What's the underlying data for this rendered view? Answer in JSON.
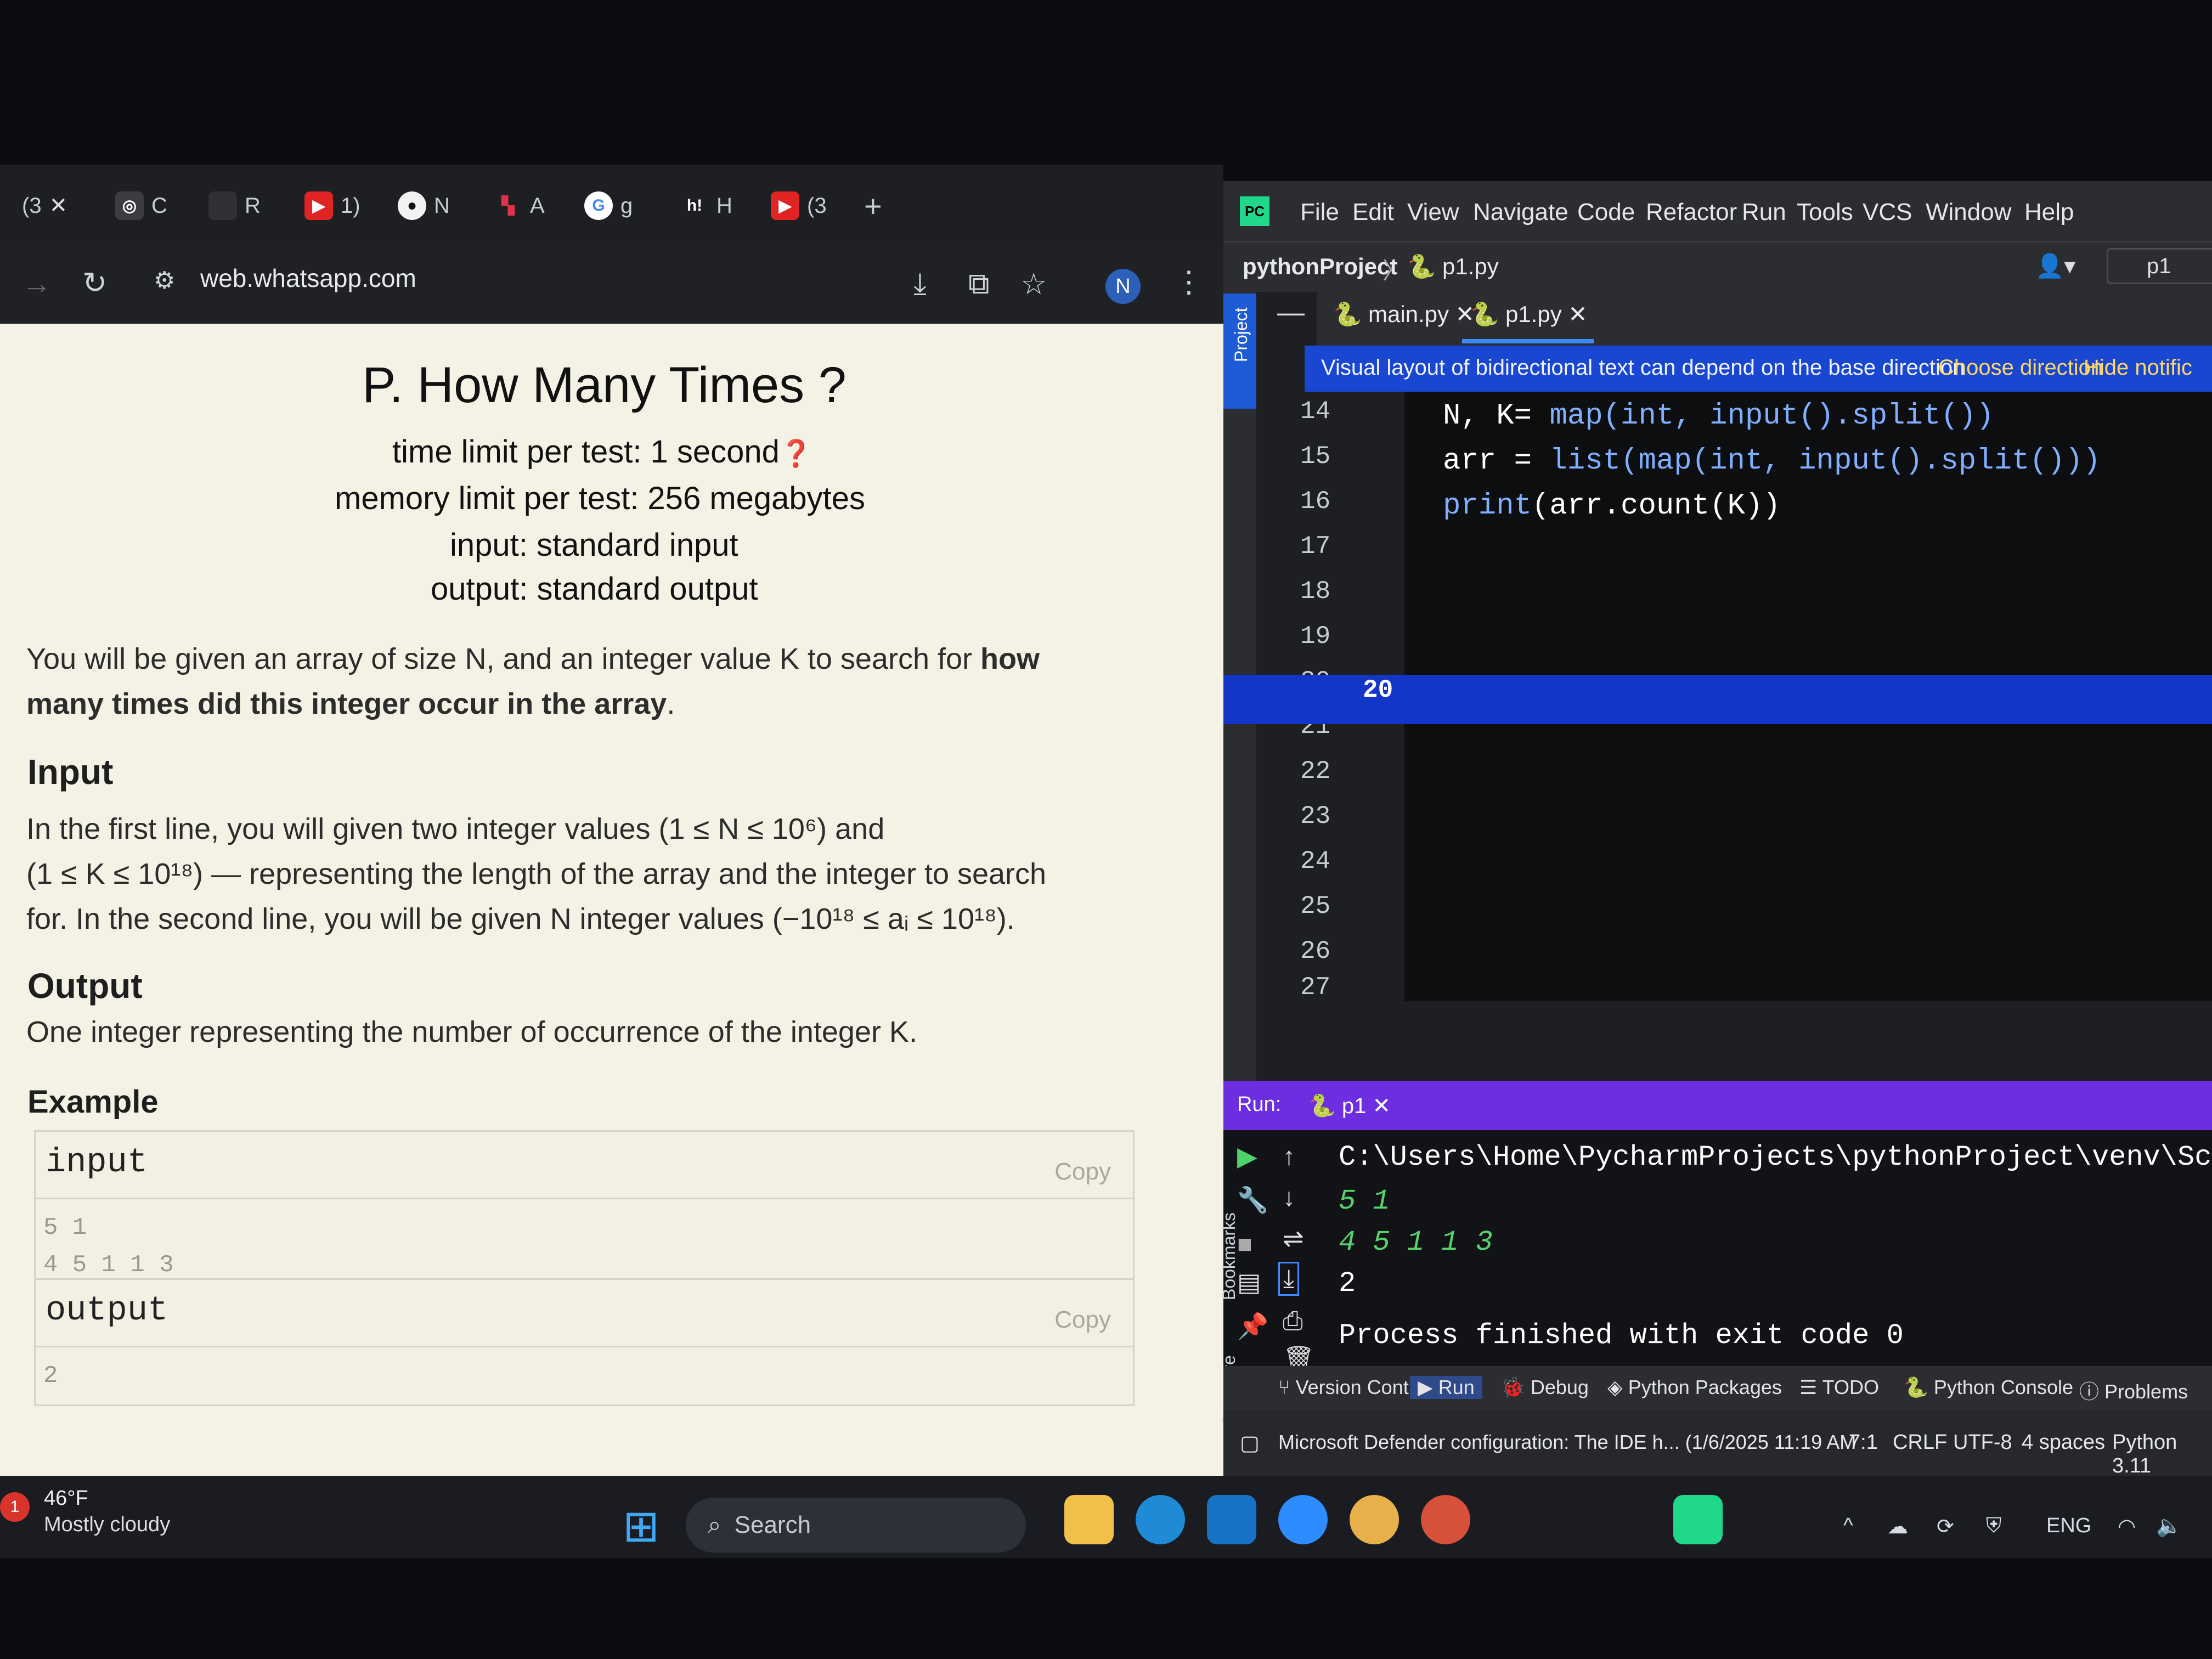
{
  "browser": {
    "tabs": [
      {
        "icon": "whatsapp-icon",
        "label": "(3"
      },
      {
        "icon": "openai-icon",
        "label": "C"
      },
      {
        "icon": "tab-icon",
        "label": "R"
      },
      {
        "icon": "youtube-icon",
        "label": "1)"
      },
      {
        "icon": "github-icon",
        "label": "N"
      },
      {
        "icon": "app-icon",
        "label": "A"
      },
      {
        "icon": "google-icon",
        "label": "g"
      },
      {
        "icon": "h-icon",
        "label": "H"
      },
      {
        "icon": "youtube-icon",
        "label": "(3"
      }
    ],
    "new_tab": "+",
    "url": "web.whatsapp.com",
    "profile_initial": "N"
  },
  "problem": {
    "title": "P. How Many Times ?",
    "time_limit": "time limit per test: 1 second",
    "memory_limit": "memory limit per test: 256 megabytes",
    "input_file": "input: standard input",
    "output_file": "output: standard output",
    "statement_1": "You will be given an array of size N, and an integer value K to search for",
    "statement_bold_1": "how",
    "statement_bold_2": "many times did this integer occur in the array",
    "statement_end": ".",
    "input_heading": "Input",
    "input_line_1": "In the first line, you will given two integer values (1 ≤ N ≤ 10⁶) and",
    "input_line_2": "(1 ≤ K ≤ 10¹⁸)  — representing the length of the array and the integer to search",
    "input_line_3": "for. In the second line, you will be given N integer values (−10¹⁸ ≤ aᵢ ≤ 10¹⁸).",
    "output_heading": "Output",
    "output_line": "One integer representing the number of occurrence of the integer K.",
    "example_heading": "Example",
    "example_input_label": "input",
    "example_output_label": "output",
    "copy_label": "Copy",
    "example_input": "5 1\n4 5 1 1 3",
    "example_output": "2"
  },
  "ide": {
    "menu": [
      "File",
      "Edit",
      "View",
      "Navigate",
      "Code",
      "Refactor",
      "Run",
      "Tools",
      "VCS",
      "Window",
      "Help"
    ],
    "breadcrumb_project": "pythonProject",
    "breadcrumb_file": "p1.py",
    "run_config": "p1",
    "tabs": [
      "main.py",
      "p1.py"
    ],
    "notification": "Visual layout of bidirectional text can depend on the base direction",
    "notification_action": "Choose direction",
    "notification_hide": "Hide notific",
    "line_numbers": [
      "14",
      "15",
      "16",
      "17",
      "18",
      "19",
      "20",
      "21",
      "22",
      "23",
      "24",
      "25",
      "26",
      "27"
    ],
    "code": {
      "line14_a": "N, K= ",
      "line14_b": "map(int, input().split())",
      "line15_a": "arr = ",
      "line15_b": "list(map(int, input().split()))",
      "line16_a": "print",
      "line16_b": "(arr.count(K))"
    },
    "project_side_label": "Project",
    "bookmarks_side_label": "Bookmarks",
    "structure_side_label": "Structure",
    "run_label": "Run:",
    "run_tab": "p1",
    "console": {
      "path": "C:\\Users\\Home\\PycharmProjects\\pythonProject\\venv\\Scripts",
      "in1": "5 1",
      "in2": "4 5 1 1 3",
      "out": "2",
      "finished": "Process finished with exit code 0"
    },
    "tool_windows": [
      "Version Control",
      "Run",
      "Debug",
      "Python Packages",
      "TODO",
      "Python Console",
      "Problems"
    ],
    "status_message": "Microsoft Defender configuration: The IDE h... (1/6/2025 11:19 AM",
    "status_position": "7:1",
    "status_crlf": "CRLF",
    "status_encoding": "UTF-8",
    "status_indent": "4 spaces",
    "status_python": "Python 3.11"
  },
  "taskbar": {
    "weather_temp": "46°F",
    "weather_desc": "Mostly cloudy",
    "weather_badge": "1",
    "search_placeholder": "Search",
    "language": "ENG"
  }
}
